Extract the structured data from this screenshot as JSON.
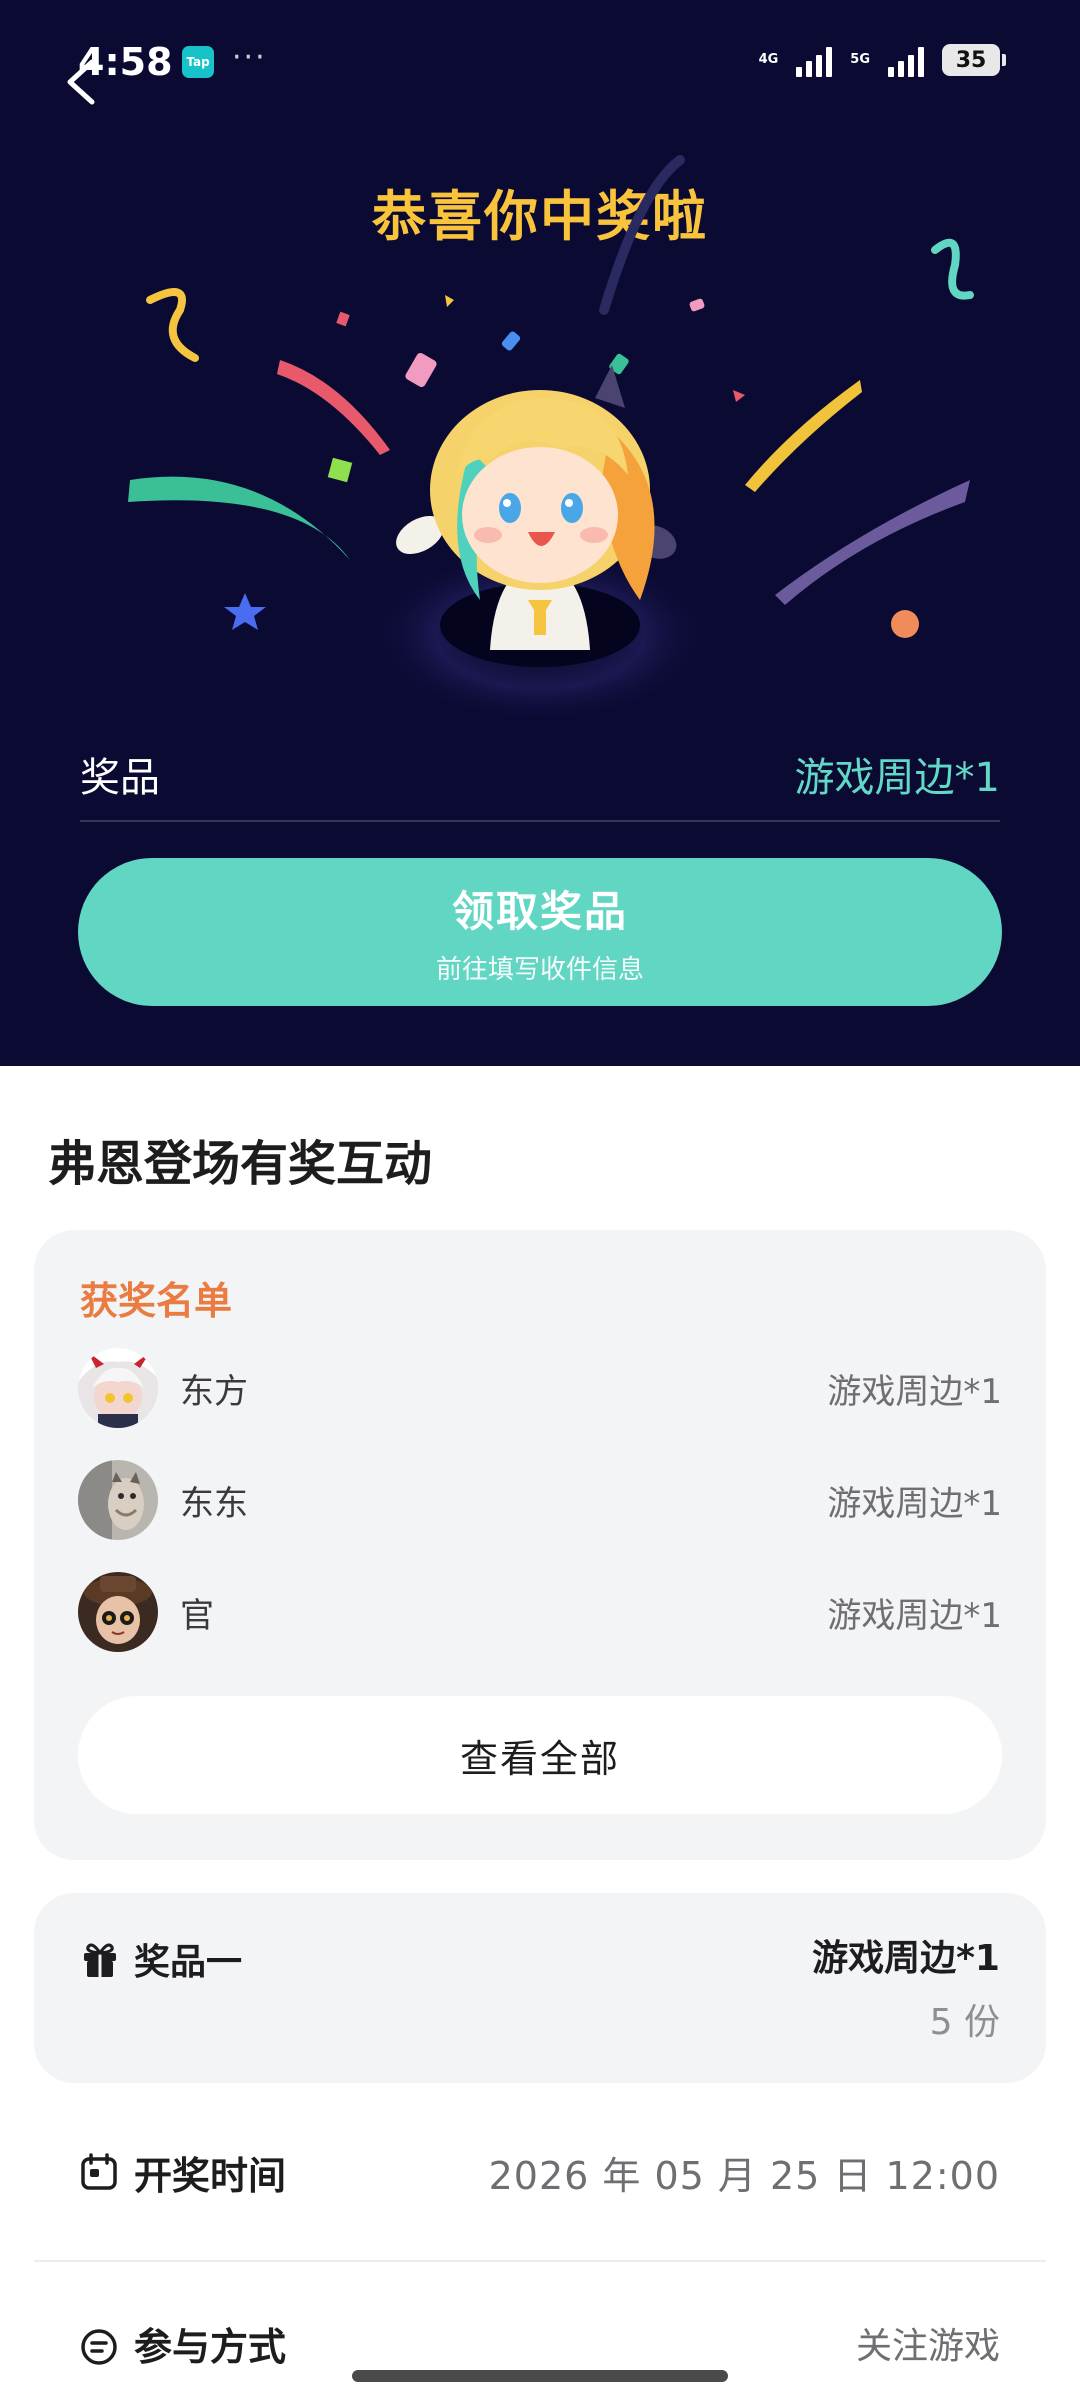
{
  "status_bar": {
    "time": "4:58",
    "app_badge": "Tap",
    "more": "···",
    "network_1": "4G",
    "network_2": "5G",
    "battery": "35"
  },
  "banner": {
    "title": "恭喜你中奖啦",
    "prize_label": "奖品",
    "prize_value": "游戏周边*1",
    "claim_title": "领取奖品",
    "claim_subtitle": "前往填写收件信息"
  },
  "activity": {
    "title": "弗恩登场有奖互动"
  },
  "winners": {
    "title": "获奖名单",
    "list": [
      {
        "name": "东方",
        "prize": "游戏周边*1"
      },
      {
        "name": "东东",
        "prize": "游戏周边*1"
      },
      {
        "name": "官",
        "prize": "游戏周边*1"
      }
    ],
    "view_all": "查看全部"
  },
  "prize_info": {
    "name": "奖品一",
    "item": "游戏周边*1",
    "count": "5 份"
  },
  "draw_time": {
    "label": "开奖时间",
    "value": "2026 年 05 月 25 日 12:00"
  },
  "participation": {
    "label": "参与方式",
    "value": "关注游戏"
  },
  "colors": {
    "banner_bg": "#0b0a33",
    "title": "#f9c33c",
    "accent": "#61d6c3",
    "winners_title": "#ea7b41"
  }
}
